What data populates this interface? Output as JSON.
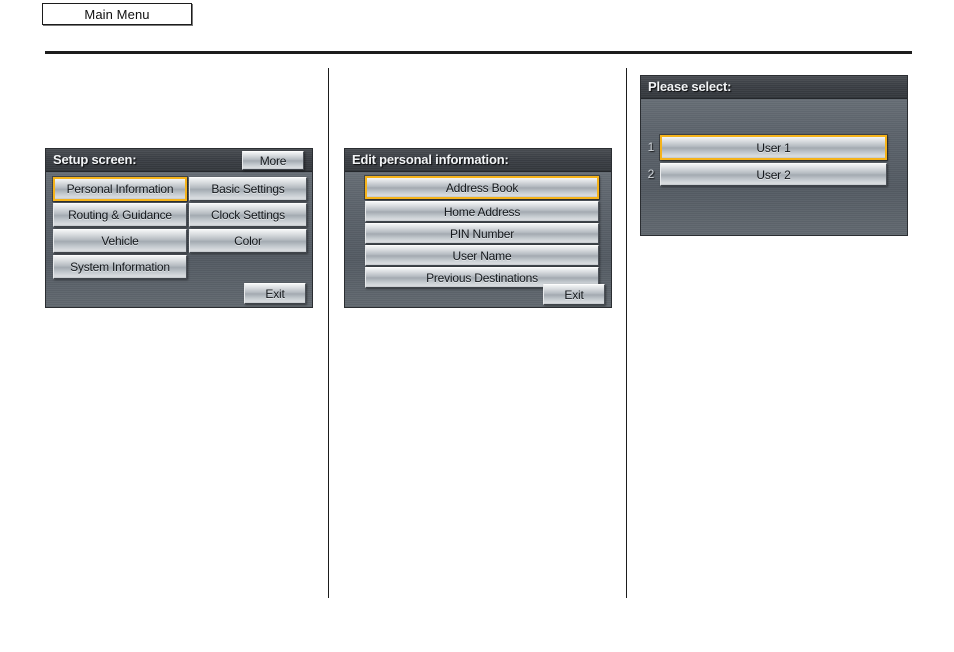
{
  "page": {
    "tab_label": "Main Menu"
  },
  "colors": {
    "highlight": "#f5b31a",
    "panel_bg": "#5d646c",
    "titlebar": "#3c4046",
    "rule": "#1d1d1d"
  },
  "panel_setup": {
    "title": "Setup screen:",
    "more_label": "More",
    "exit_label": "Exit",
    "buttons": [
      {
        "label": "Personal Information",
        "selected": true
      },
      {
        "label": "Basic Settings",
        "selected": false
      },
      {
        "label": "Routing & Guidance",
        "selected": false
      },
      {
        "label": "Clock Settings",
        "selected": false
      },
      {
        "label": "Vehicle",
        "selected": false
      },
      {
        "label": "Color",
        "selected": false
      },
      {
        "label": "System Information",
        "selected": false
      }
    ]
  },
  "panel_edit": {
    "title": "Edit personal information:",
    "exit_label": "Exit",
    "buttons": [
      {
        "label": "Address Book",
        "selected": true
      },
      {
        "label": "Home Address",
        "selected": false
      },
      {
        "label": "PIN Number",
        "selected": false
      },
      {
        "label": "User Name",
        "selected": false
      },
      {
        "label": "Previous Destinations",
        "selected": false
      }
    ]
  },
  "panel_select": {
    "title": "Please select:",
    "rows": [
      {
        "number": "1",
        "label": "User 1",
        "selected": true
      },
      {
        "number": "2",
        "label": "User 2",
        "selected": false
      }
    ]
  }
}
